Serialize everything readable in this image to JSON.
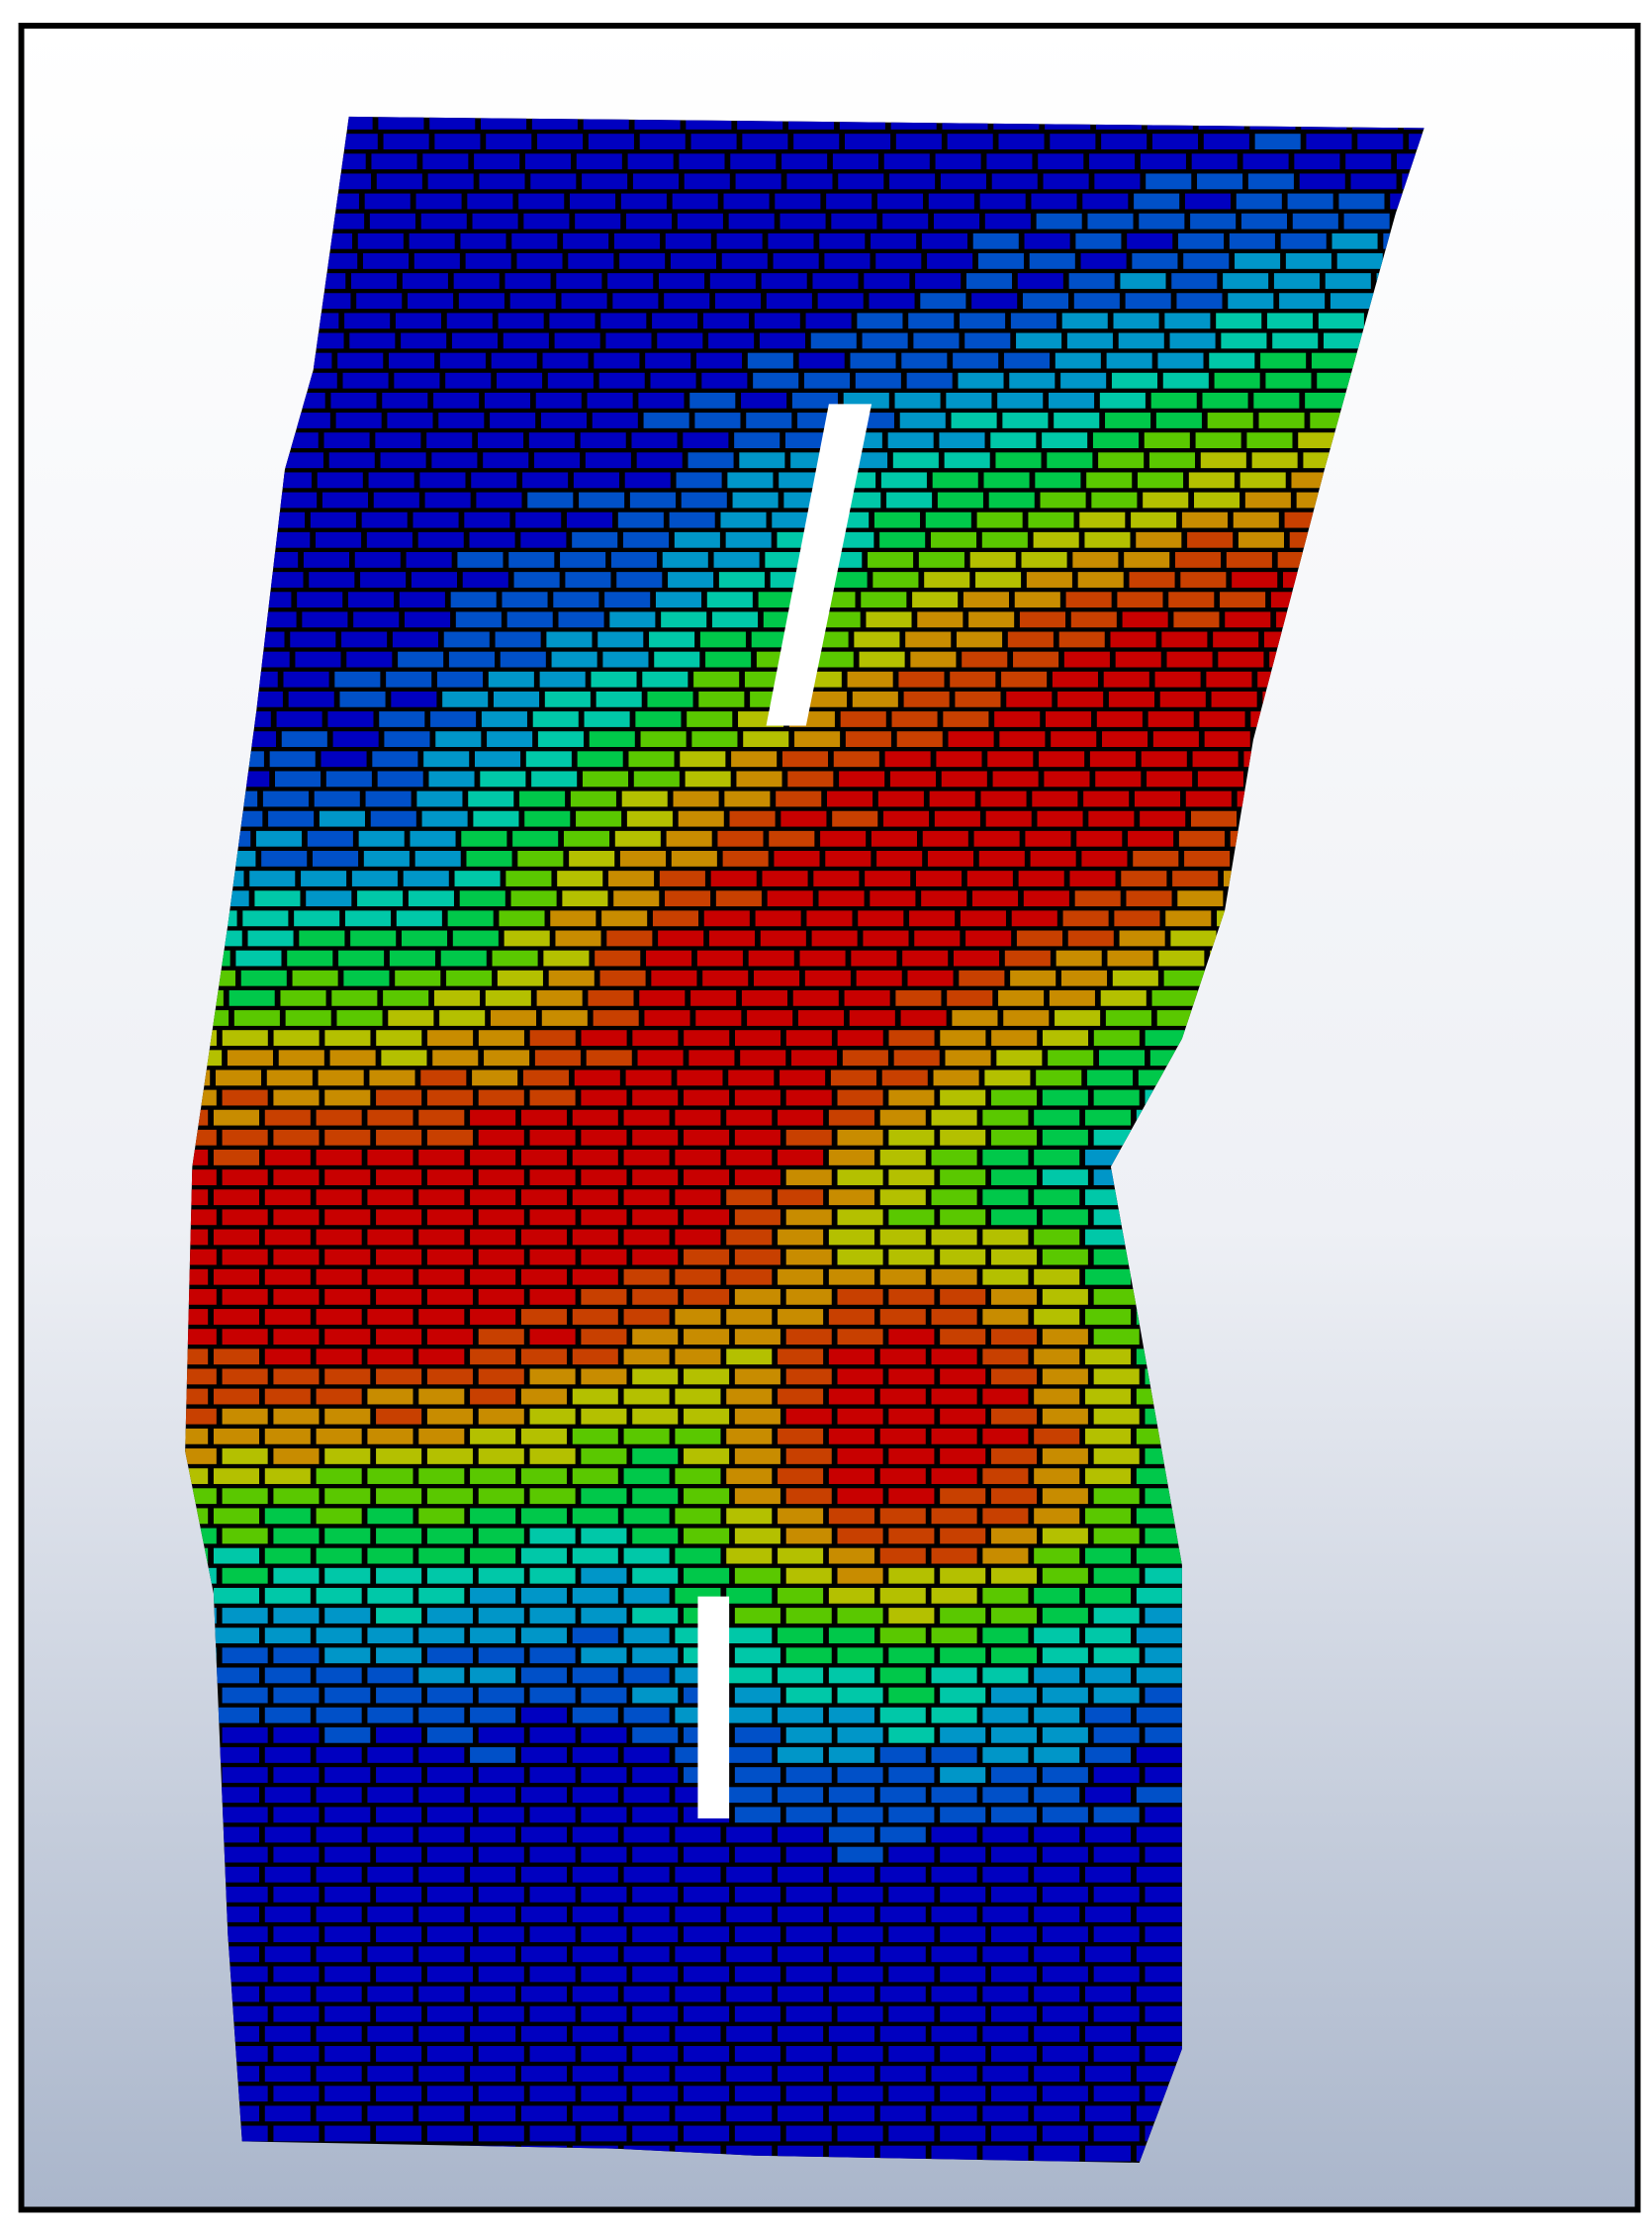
{
  "viewport": {
    "background_top": "#ffffff",
    "background_bottom": "#aab6cb",
    "frame_color": "#000000",
    "mesh_edge_color": "#000000",
    "opening_color": "#ffffff"
  },
  "contour": {
    "colormap": [
      "#0000c0",
      "#0050c8",
      "#0096c8",
      "#00c8a8",
      "#00c84a",
      "#5ac800",
      "#b4c000",
      "#c88c00",
      "#c84000",
      "#c80000"
    ]
  }
}
